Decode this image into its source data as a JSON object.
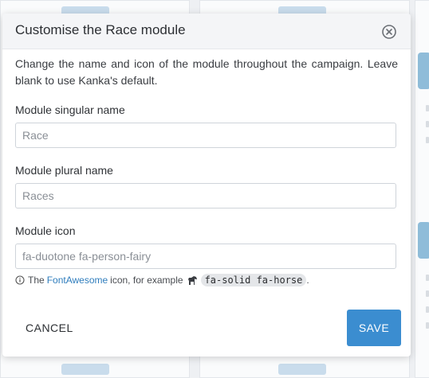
{
  "modal": {
    "title": "Customise the Race module",
    "description": "Change the name and icon of the module throughout the campaign. Leave blank to use Kanka's default.",
    "singular": {
      "label": "Module singular name",
      "placeholder": "Race"
    },
    "plural": {
      "label": "Module plural name",
      "placeholder": "Races"
    },
    "icon": {
      "label": "Module icon",
      "placeholder": "fa-duotone fa-person-fairy"
    },
    "help": {
      "prefix": "The",
      "link": "FontAwesome",
      "middle": "icon, for example",
      "code": "fa-solid fa-horse",
      "suffix": "."
    },
    "cancel_label": "CANCEL",
    "save_label": "SAVE"
  },
  "colors": {
    "accent": "#3b8dd0",
    "link": "#2f7dbd"
  },
  "icons": [
    "close-icon",
    "info-icon",
    "horse-icon"
  ]
}
